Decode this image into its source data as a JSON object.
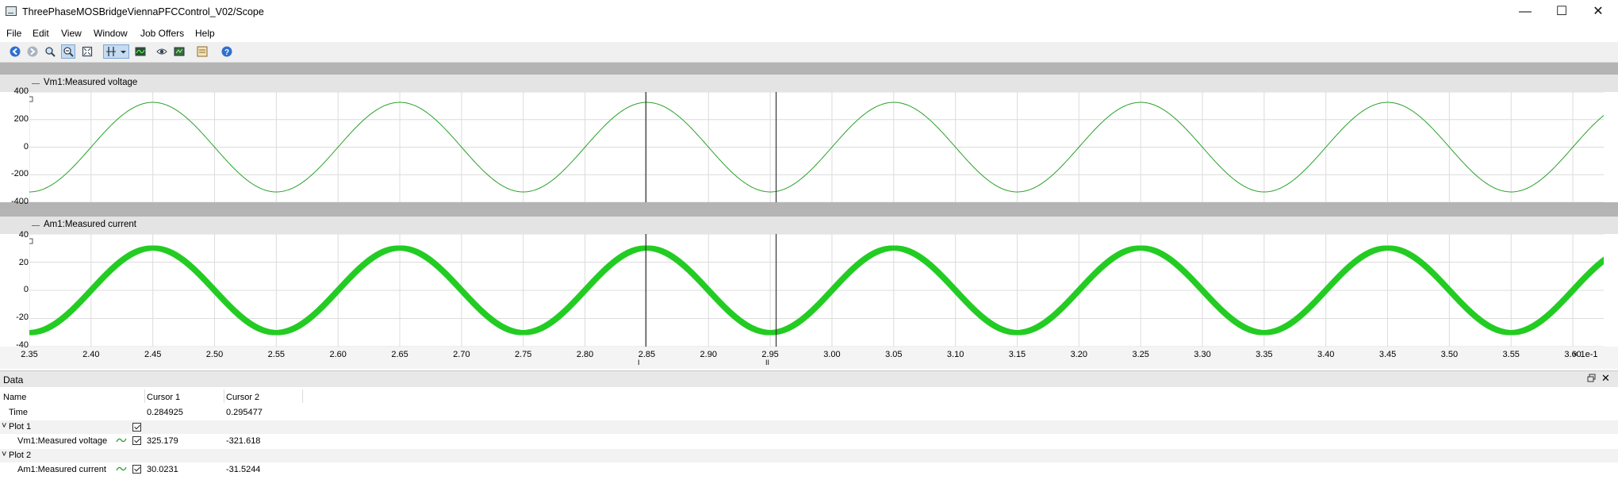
{
  "window": {
    "title": "ThreePhaseMOSBridgeViennaPFCControl_V02/Scope",
    "controls": {
      "minimize": "—",
      "maximize": "☐",
      "close": "✕"
    }
  },
  "menu": [
    "File",
    "Edit",
    "View",
    "Window",
    "Job Offers",
    "Help"
  ],
  "toolbar": {
    "icons": [
      "back-icon",
      "forward-icon",
      "zoom-icon",
      "zoom-out-icon",
      "zoom-fit-icon",
      "cursor-icon",
      "dropdown-icon",
      "trace-icon",
      "eye-icon",
      "export-icon",
      "screenshot-icon",
      "properties-icon",
      "help-icon"
    ]
  },
  "plots": [
    {
      "legend": "Vm1:Measured voltage",
      "yticks": [
        "400",
        "200",
        "0",
        "-200",
        "-400"
      ],
      "color": "#2aa02a"
    },
    {
      "legend": "Am1:Measured current",
      "yticks": [
        "40",
        "20",
        "0",
        "-20",
        "-40"
      ],
      "color": "#22cc22"
    }
  ],
  "chart_data": [
    {
      "type": "line",
      "series": [
        {
          "name": "Vm1:Measured voltage",
          "amplitude": 325,
          "frequency_hz": 50,
          "peak_at": 0.245
        }
      ],
      "xlim": [
        0.235,
        0.3625
      ],
      "ylim": [
        -400,
        400
      ],
      "grid": true
    },
    {
      "type": "line",
      "series": [
        {
          "name": "Am1:Measured current",
          "amplitude": 30,
          "frequency_hz": 50,
          "peak_at": 0.245,
          "ripple": 3
        }
      ],
      "xlim": [
        0.235,
        0.3625
      ],
      "ylim": [
        -40,
        40
      ],
      "grid": true
    }
  ],
  "xaxis": {
    "ticks": [
      "2.35",
      "2.40",
      "2.45",
      "2.50",
      "2.55",
      "2.60",
      "2.65",
      "2.70",
      "2.75",
      "2.80",
      "2.85",
      "2.90",
      "2.95",
      "3.00",
      "3.05",
      "3.10",
      "3.15",
      "3.20",
      "3.25",
      "3.30",
      "3.35",
      "3.40",
      "3.45",
      "3.50",
      "3.55",
      "3.60"
    ],
    "exponent": "× 1e-1"
  },
  "cursors": [
    {
      "label": "I",
      "time": 0.284925
    },
    {
      "label": "II",
      "time": 0.295477
    }
  ],
  "data_panel": {
    "title": "Data",
    "columns": [
      "Name",
      "Cursor 1",
      "Cursor 2"
    ],
    "time_row": {
      "name": "Time",
      "c1": "0.284925",
      "c2": "0.295477"
    },
    "groups": [
      {
        "name": "Plot 1",
        "signal": "Vm1:Measured voltage",
        "c1": "325.179",
        "c2": "-321.618"
      },
      {
        "name": "Plot 2",
        "signal": "Am1:Measured current",
        "c1": "30.0231",
        "c2": "-31.5244"
      }
    ]
  }
}
